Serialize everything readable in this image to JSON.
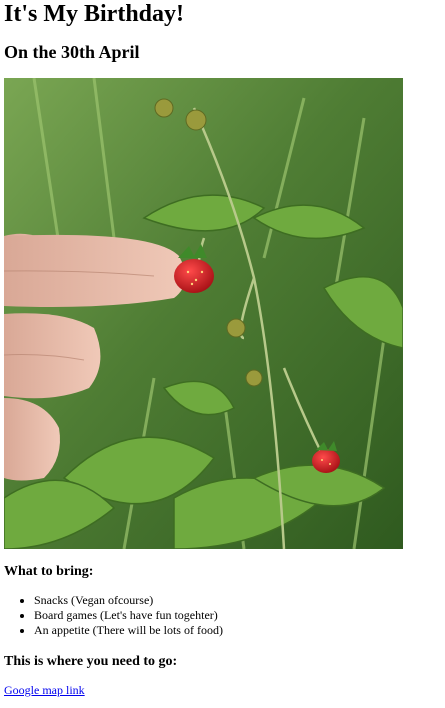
{
  "title": "It's My Birthday!",
  "subtitle": "On the 30th April",
  "photo": {
    "subject": "wild strawberry plant with a finger pointing at a red berry"
  },
  "bring": {
    "heading": "What to bring:",
    "items": [
      "Snacks (Vegan ofcourse)",
      "Board games (Let's have fun togehter)",
      "An appetite (There will be lots of food)"
    ]
  },
  "location": {
    "heading": "This is where you need to go:",
    "link_label": "Google map link"
  },
  "colors": {
    "link": "#0000ee",
    "text": "#000000",
    "background": "#ffffff"
  }
}
